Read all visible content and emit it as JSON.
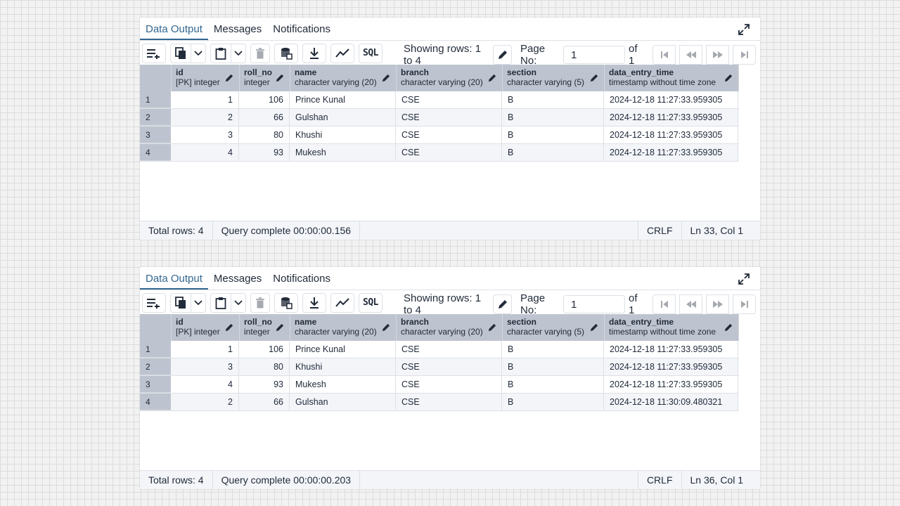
{
  "panels": [
    {
      "tabs": [
        "Data Output",
        "Messages",
        "Notifications"
      ],
      "active_tab": "Data Output",
      "rows_info": "Showing rows: 1 to 4",
      "page_label": "Page No:",
      "page_value": "1",
      "page_of": "of 1",
      "sql_label": "SQL",
      "columns": [
        {
          "name": "id",
          "type": "[PK] integer"
        },
        {
          "name": "roll_no",
          "type": "integer"
        },
        {
          "name": "name",
          "type": "character varying (20)"
        },
        {
          "name": "branch",
          "type": "character varying (20)"
        },
        {
          "name": "section",
          "type": "character varying (5)"
        },
        {
          "name": "data_entry_time",
          "type": "timestamp without time zone"
        }
      ],
      "rows": [
        {
          "rownum": "1",
          "id": "1",
          "roll_no": "106",
          "name": "Prince Kunal",
          "branch": "CSE",
          "section": "B",
          "time": "2024-12-18 11:27:33.959305"
        },
        {
          "rownum": "2",
          "id": "2",
          "roll_no": "66",
          "name": "Gulshan",
          "branch": "CSE",
          "section": "B",
          "time": "2024-12-18 11:27:33.959305"
        },
        {
          "rownum": "3",
          "id": "3",
          "roll_no": "80",
          "name": "Khushi",
          "branch": "CSE",
          "section": "B",
          "time": "2024-12-18 11:27:33.959305"
        },
        {
          "rownum": "4",
          "id": "4",
          "roll_no": "93",
          "name": "Mukesh",
          "branch": "CSE",
          "section": "B",
          "time": "2024-12-18 11:27:33.959305"
        }
      ],
      "status": {
        "total": "Total rows: 4",
        "query": "Query complete 00:00:00.156",
        "eol": "CRLF",
        "position": "Ln 33, Col 1"
      }
    },
    {
      "tabs": [
        "Data Output",
        "Messages",
        "Notifications"
      ],
      "active_tab": "Data Output",
      "rows_info": "Showing rows: 1 to 4",
      "page_label": "Page No:",
      "page_value": "1",
      "page_of": "of 1",
      "sql_label": "SQL",
      "columns": [
        {
          "name": "id",
          "type": "[PK] integer"
        },
        {
          "name": "roll_no",
          "type": "integer"
        },
        {
          "name": "name",
          "type": "character varying (20)"
        },
        {
          "name": "branch",
          "type": "character varying (20)"
        },
        {
          "name": "section",
          "type": "character varying (5)"
        },
        {
          "name": "data_entry_time",
          "type": "timestamp without time zone"
        }
      ],
      "rows": [
        {
          "rownum": "1",
          "id": "1",
          "roll_no": "106",
          "name": "Prince Kunal",
          "branch": "CSE",
          "section": "B",
          "time": "2024-12-18 11:27:33.959305"
        },
        {
          "rownum": "2",
          "id": "3",
          "roll_no": "80",
          "name": "Khushi",
          "branch": "CSE",
          "section": "B",
          "time": "2024-12-18 11:27:33.959305"
        },
        {
          "rownum": "3",
          "id": "4",
          "roll_no": "93",
          "name": "Mukesh",
          "branch": "CSE",
          "section": "B",
          "time": "2024-12-18 11:27:33.959305"
        },
        {
          "rownum": "4",
          "id": "2",
          "roll_no": "66",
          "name": "Gulshan",
          "branch": "CSE",
          "section": "B",
          "time": "2024-12-18 11:30:09.480321"
        }
      ],
      "status": {
        "total": "Total rows: 4",
        "query": "Query complete 00:00:00.203",
        "eol": "CRLF",
        "position": "Ln 36, Col 1"
      }
    }
  ]
}
